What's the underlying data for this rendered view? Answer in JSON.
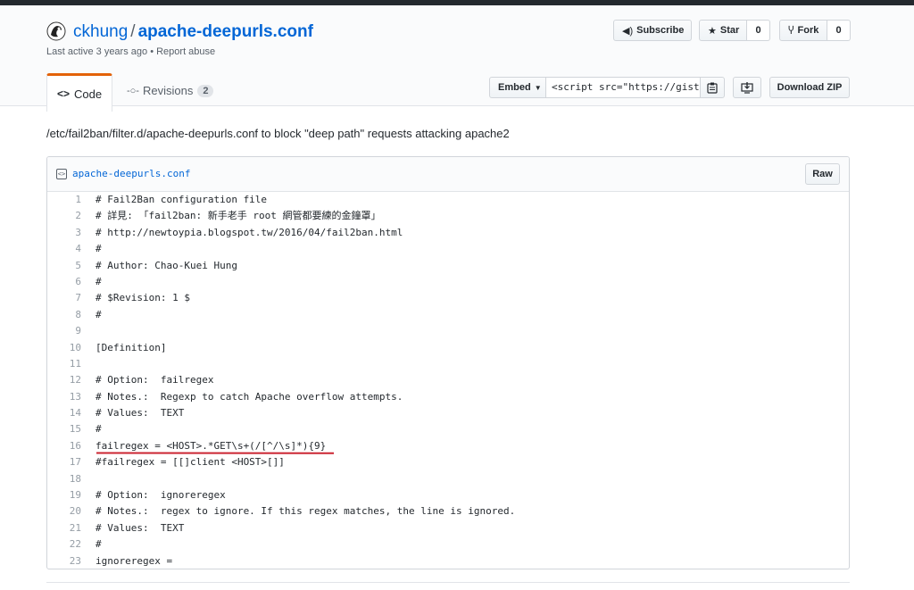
{
  "header": {
    "owner": "ckhung",
    "separator": "/",
    "repo": "apache-deepurls.conf",
    "meta_active": "Last active 3 years ago",
    "meta_sep": "•",
    "meta_report": "Report abuse"
  },
  "actions": {
    "subscribe_label": "Subscribe",
    "star_label": "Star",
    "star_count": "0",
    "fork_label": "Fork",
    "fork_count": "0",
    "embed_label": "Embed",
    "embed_value": "<script src=\"https://gist",
    "download_label": "Download ZIP"
  },
  "tabs": {
    "code_label": "Code",
    "revisions_label": "Revisions",
    "revisions_count": "2"
  },
  "description": "/etc/fail2ban/filter.d/apache-deepurls.conf to block \"deep path\" requests attacking apache2",
  "file": {
    "name": "apache-deepurls.conf",
    "raw_label": "Raw",
    "lines": [
      {
        "n": "1",
        "text": "# Fail2Ban configuration file"
      },
      {
        "n": "2",
        "text": "# 詳見: 「fail2ban: 新手老手 root 網管都要練的金鐘罩」"
      },
      {
        "n": "3",
        "text": "# http://newtoypia.blogspot.tw/2016/04/fail2ban.html"
      },
      {
        "n": "4",
        "text": "#"
      },
      {
        "n": "5",
        "text": "# Author: Chao-Kuei Hung"
      },
      {
        "n": "6",
        "text": "#"
      },
      {
        "n": "7",
        "text": "# $Revision: 1 $"
      },
      {
        "n": "8",
        "text": "#"
      },
      {
        "n": "9",
        "text": ""
      },
      {
        "n": "10",
        "text": "[Definition]"
      },
      {
        "n": "11",
        "text": ""
      },
      {
        "n": "12",
        "text": "# Option:  failregex"
      },
      {
        "n": "13",
        "text": "# Notes.:  Regexp to catch Apache overflow attempts."
      },
      {
        "n": "14",
        "text": "# Values:  TEXT"
      },
      {
        "n": "15",
        "text": "#"
      },
      {
        "n": "16",
        "text": "failregex = <HOST>.*GET\\s+(/[^/\\s]*){9}"
      },
      {
        "n": "17",
        "text": "#failregex = [[]client <HOST>[]]"
      },
      {
        "n": "18",
        "text": ""
      },
      {
        "n": "19",
        "text": "# Option:  ignoreregex"
      },
      {
        "n": "20",
        "text": "# Notes.:  regex to ignore. If this regex matches, the line is ignored."
      },
      {
        "n": "21",
        "text": "# Values:  TEXT"
      },
      {
        "n": "22",
        "text": "#"
      },
      {
        "n": "23",
        "text": "ignoreregex ="
      }
    ]
  },
  "colors": {
    "link": "#0366d6",
    "tab_accent": "#e36209",
    "annotation_underline": "#cb2431"
  }
}
